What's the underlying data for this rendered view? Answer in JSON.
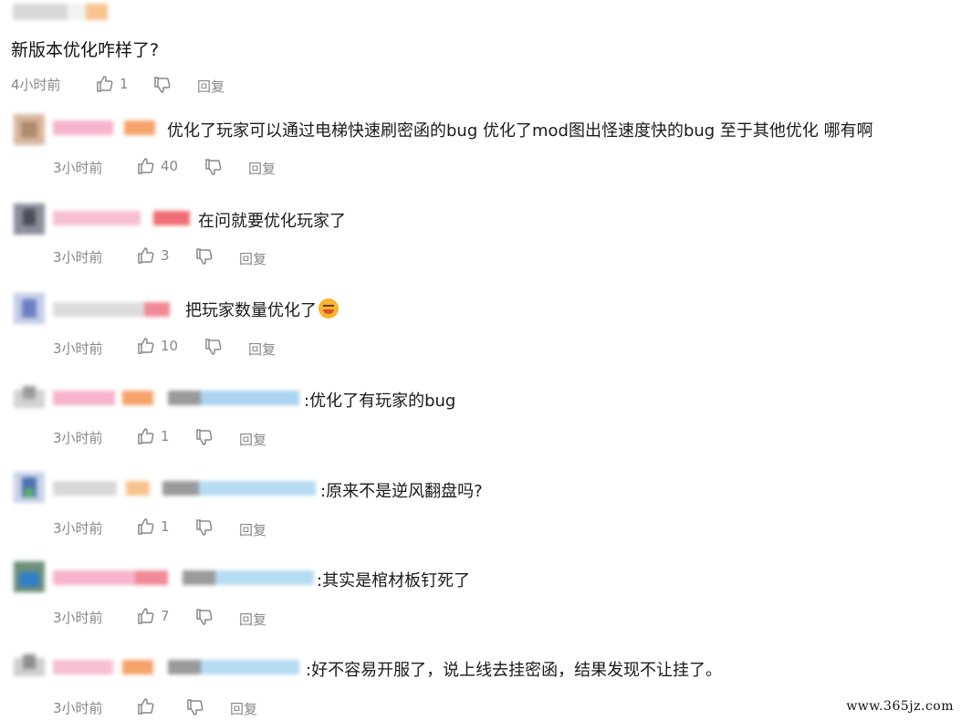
{
  "post": {
    "title": "新版本优化咋样了?",
    "time": "4小时前",
    "likes": "1",
    "reply_label": "回复"
  },
  "comments": [
    {
      "text": "优化了玩家可以通过电梯快速刷密函的bug 优化了mod图出怪速度快的bug 至于其他优化 哪有啊",
      "time": "3小时前",
      "likes": "40",
      "reply_label": "回复"
    },
    {
      "text": "在问就要优化玩家了",
      "time": "3小时前",
      "likes": "3",
      "reply_label": "回复"
    },
    {
      "text": "把玩家数量优化了",
      "time": "3小时前",
      "likes": "10",
      "reply_label": "回复",
      "emoji": "laughing-crying-emoji"
    },
    {
      "text": ":优化了有玩家的bug",
      "time": "3小时前",
      "likes": "1",
      "reply_label": "回复"
    },
    {
      "text": ":原来不是逆风翻盘吗?",
      "time": "3小时前",
      "likes": "1",
      "reply_label": "回复"
    },
    {
      "text": ":其实是棺材板钉死了",
      "time": "3小时前",
      "likes": "7",
      "reply_label": "回复"
    },
    {
      "text": ":好不容易开服了，说上线去挂密函，结果发现不让挂了。",
      "time": "3小时前",
      "likes": "",
      "reply_label": "回复"
    }
  ],
  "watermark": "www.365jz.com",
  "icons": {
    "like": "thumbs-up-icon",
    "dislike": "thumbs-down-icon"
  },
  "colors": {
    "text": "#1a1a1a",
    "meta": "#888888",
    "username_pink": "#f4a7c3",
    "username_blue": "#a9d3f0",
    "username_orange": "#f5a36a"
  }
}
